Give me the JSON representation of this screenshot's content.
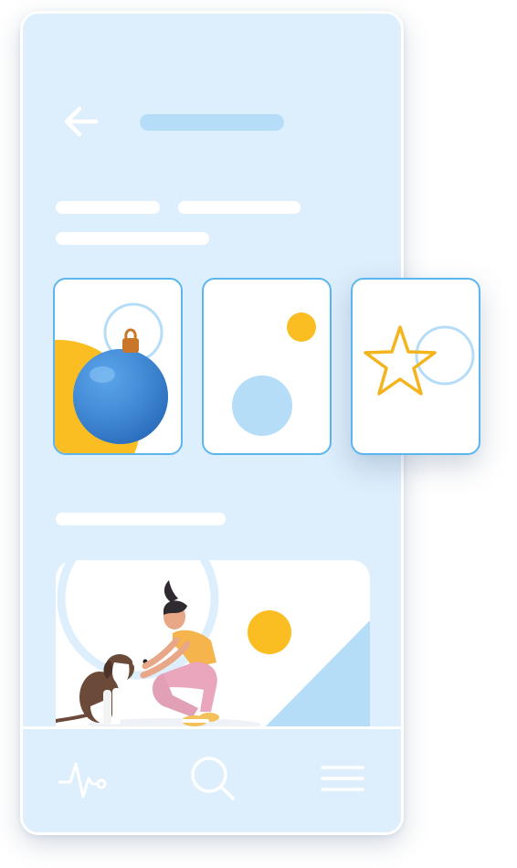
{
  "header": {
    "back_icon": "arrow-left-icon"
  },
  "cards": [
    {
      "id": "ornament",
      "icon": "christmas-ornament-icon"
    },
    {
      "id": "circles",
      "icon": "circles-icon"
    },
    {
      "id": "star",
      "icon": "star-icon"
    }
  ],
  "featured": {
    "illustration": "woman-petting-dog"
  },
  "tabbar": {
    "items": [
      {
        "icon": "heartbeat-icon"
      },
      {
        "icon": "search-icon"
      },
      {
        "icon": "menu-icon"
      }
    ]
  },
  "colors": {
    "phone_background": "#ddeefc",
    "accent_blue": "#5bb6ee",
    "light_blue": "#b5ddf8",
    "yellow": "#fbbe22",
    "ornament_blue": "#3d8ee0",
    "star_yellow": "#f3b41d"
  }
}
